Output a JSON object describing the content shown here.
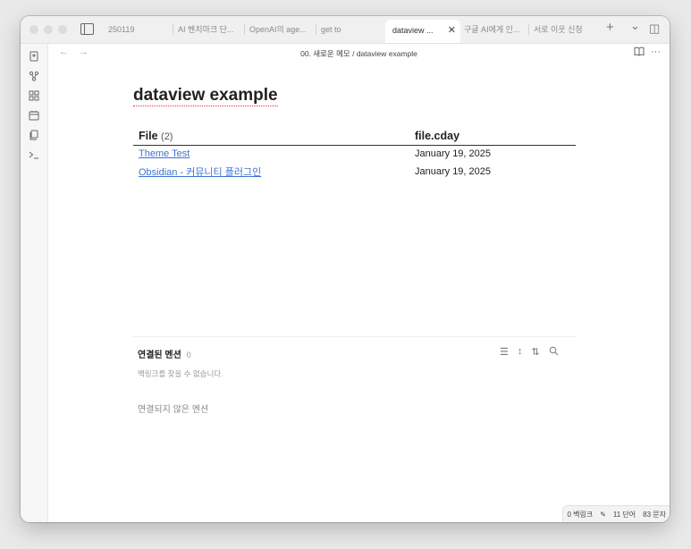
{
  "tabs": [
    {
      "label": "250119",
      "active": false
    },
    {
      "label": "AI 벤치마크 단...",
      "active": false
    },
    {
      "label": "OpenAI의 age...",
      "active": false
    },
    {
      "label": "get to",
      "active": false
    },
    {
      "label": "dataview ...",
      "active": true
    },
    {
      "label": "구글 AI에게 인...",
      "active": false
    },
    {
      "label": "서로 이웃 신청",
      "active": false
    }
  ],
  "tabbar_icons": {
    "new_tab": "+",
    "tab_list": "⌄",
    "right_sidebar": "◫"
  },
  "ribbon_icons": [
    "file-explorer-icon",
    "graph-view-icon",
    "canvas-icon",
    "daily-note-icon",
    "templates-icon",
    "terminal-icon"
  ],
  "nav": {
    "back": "←",
    "forward": "→",
    "breadcrumb": "00. 새로운 메모 / dataview example",
    "reading_view_icon": "book-open-icon",
    "more_icon": "···"
  },
  "note": {
    "title": "dataview example",
    "table": {
      "headers": [
        "File",
        "file.cday"
      ],
      "count": "(2)",
      "rows": [
        {
          "file": "Theme Test",
          "cday": "January 19, 2025"
        },
        {
          "file": "Obsidian - 커뮤니티 플러그인",
          "cday": "January 19, 2025"
        }
      ]
    }
  },
  "backlinks": {
    "title": "연결된 멘션",
    "count": "0",
    "empty": "백링크를 찾을 수 없습니다.",
    "unlinked": "연결되지 않은 멘션"
  },
  "status": {
    "backlinks": "0 백링크",
    "edit_icon": "✎",
    "words": "11 단어",
    "chars": "83 문자"
  }
}
